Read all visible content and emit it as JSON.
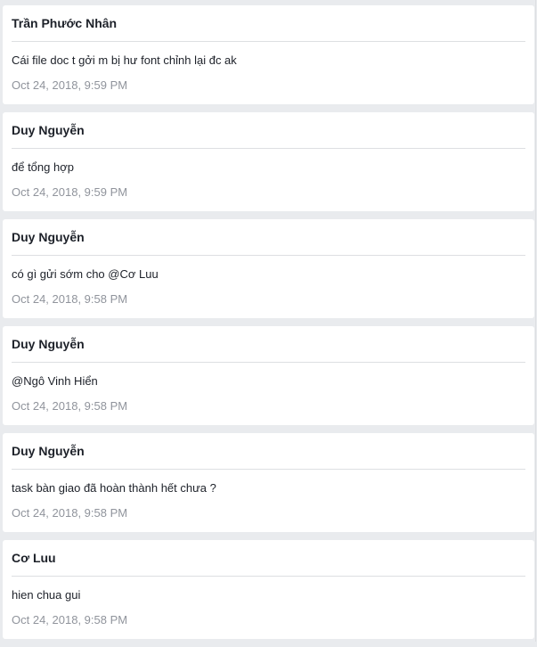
{
  "comments": [
    {
      "author": "Trần Phước Nhân",
      "message": "Cái file doc t gởi m bị hư font chỉnh lại đc ak",
      "time": "Oct 24, 2018, 9:59 PM"
    },
    {
      "author": "Duy Nguyễn",
      "message": "để tổng hợp",
      "time": "Oct 24, 2018, 9:59 PM"
    },
    {
      "author": "Duy Nguyễn",
      "message": "có gì gửi sớm cho @Cơ Luu",
      "time": "Oct 24, 2018, 9:58 PM"
    },
    {
      "author": "Duy Nguyễn",
      "message": "@Ngô Vinh Hiển",
      "time": "Oct 24, 2018, 9:58 PM"
    },
    {
      "author": "Duy Nguyễn",
      "message": "task bàn giao đã hoàn thành hết chưa ?",
      "time": "Oct 24, 2018, 9:58 PM"
    },
    {
      "author": "Cơ Luu",
      "message": "hien chua gui",
      "time": "Oct 24, 2018, 9:58 PM"
    }
  ]
}
